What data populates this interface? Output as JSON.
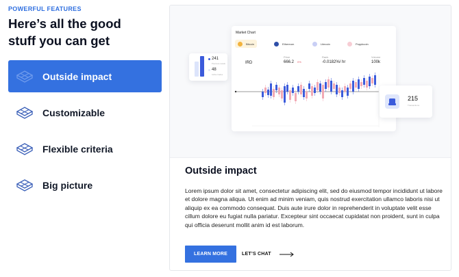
{
  "eyebrow": "POWERFUL FEATURES",
  "headline": "Here’s all the good stuff you can get",
  "features": [
    {
      "label": "Outside impact",
      "active": true
    },
    {
      "label": "Customizable",
      "active": false
    },
    {
      "label": "Flexible criteria",
      "active": false
    },
    {
      "label": "Big picture",
      "active": false
    }
  ],
  "preview": {
    "chart_title": "Market Chart",
    "tabs": [
      {
        "label": "Bitcoin",
        "color": "#f3b33d"
      },
      {
        "label": "Ethereum",
        "color": "#2f4fa8"
      },
      {
        "label": "Litecoin",
        "color": "#6b7ce0"
      },
      {
        "label": "Poppkcoin",
        "color": "#e88a9a"
      }
    ],
    "stats": [
      {
        "label": "",
        "value": "IRD"
      },
      {
        "label": "Price",
        "value": "666.2",
        "change": "0%"
      },
      {
        "label": "Rank",
        "value": "-0.0182%/ hr"
      },
      {
        "label": "Volume",
        "value": "100k"
      }
    ],
    "mini_stats": [
      {
        "value": "241",
        "label": "Precious metals"
      },
      {
        "value": "48",
        "label": "Active trades"
      }
    ],
    "badge": {
      "value": "215",
      "label": "Transactions"
    }
  },
  "detail": {
    "title": "Outside impact",
    "body": "Lorem ipsum dolor sit amet, consectetur adipiscing elit, sed do eiusmod tempor incididunt ut labore et dolore magna aliqua. Ut enim ad minim veniam, quis nostrud exercitation ullamco laboris nisi ut aliquip ex ea commodo consequat. Duis aute irure dolor in reprehenderit in voluptate velit esse cillum dolore eu fugiat nulla pariatur. Excepteur sint occaecat cupidatat non proident, sunt in culpa qui officia deserunt mollit anim id est laborum.",
    "primary_button": "LEARN MORE",
    "secondary_button": "LET’S CHAT"
  },
  "colors": {
    "accent": "#3471e0",
    "candle_up": "#3b5bdb",
    "candle_down": "#f2a9b4"
  }
}
